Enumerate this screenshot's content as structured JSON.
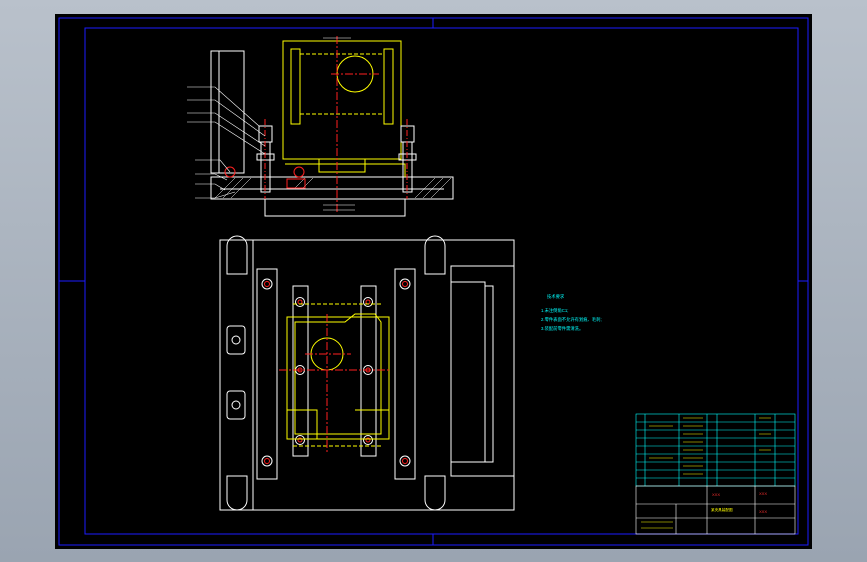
{
  "drawing": {
    "notes": {
      "heading": "技术要求",
      "lines": [
        "1.未注倒角C1;",
        "2.零件表面不允许有划痕、毛刺;",
        "3.装配前零件需清洗。"
      ]
    },
    "title_block": {
      "title": "某夹具装配图",
      "red_labels": [
        "XXX",
        "XXX",
        "XXX"
      ]
    }
  },
  "colors": {
    "background": "#000000",
    "frame": "#1c1cff",
    "outline": "#ffffff",
    "part": "#ffff00",
    "center_line": "#ff2020",
    "text": "#00ffff"
  }
}
